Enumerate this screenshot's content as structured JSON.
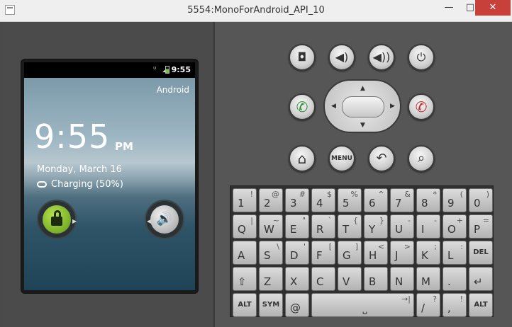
{
  "window": {
    "title": "5554:MonoForAndroid_API_10",
    "min_glyph": "—",
    "max_glyph": "□",
    "close_glyph": "✕"
  },
  "phone": {
    "status_time": "9:55",
    "status_icons": "ᵁ ◢",
    "carrier": "Android",
    "clock": "9:55",
    "ampm": "PM",
    "date": "Monday, March 16",
    "charging": "Charging (50%)",
    "sound_glyph": "🔊"
  },
  "hardware": {
    "camera_glyph": "◘",
    "vol_down_glyph": "◀)",
    "vol_up_glyph": "◀))",
    "power_glyph": "⏻",
    "call_glyph": "✆",
    "end_call_glyph": "✆",
    "home_glyph": "⌂",
    "menu_label": "MENU",
    "back_glyph": "↶",
    "search_glyph": "⌕",
    "dpad": {
      "up": "▲",
      "down": "▼",
      "left": "◀",
      "right": "▶"
    }
  },
  "keyboard": {
    "rows": [
      [
        {
          "m": "1",
          "a": "!"
        },
        {
          "m": "2",
          "a": "@"
        },
        {
          "m": "3",
          "a": "#"
        },
        {
          "m": "4",
          "a": "$"
        },
        {
          "m": "5",
          "a": "%"
        },
        {
          "m": "6",
          "a": "^"
        },
        {
          "m": "7",
          "a": "&"
        },
        {
          "m": "8",
          "a": "*"
        },
        {
          "m": "9",
          "a": "("
        },
        {
          "m": "0",
          "a": ")"
        }
      ],
      [
        {
          "m": "Q",
          "a": "|"
        },
        {
          "m": "W",
          "a": "~"
        },
        {
          "m": "E",
          "a": "\""
        },
        {
          "m": "R",
          "a": "`"
        },
        {
          "m": "T",
          "a": "{"
        },
        {
          "m": "Y",
          "a": "}"
        },
        {
          "m": "U",
          "a": "-"
        },
        {
          "m": "I",
          "a": "-"
        },
        {
          "m": "O",
          "a": "+"
        },
        {
          "m": "P",
          "a": "="
        }
      ],
      [
        {
          "m": "A",
          "a": ""
        },
        {
          "m": "S",
          "a": "\\"
        },
        {
          "m": "D",
          "a": "'"
        },
        {
          "m": "F",
          "a": "["
        },
        {
          "m": "G",
          "a": "]"
        },
        {
          "m": "H",
          "a": "<"
        },
        {
          "m": "J",
          "a": ">"
        },
        {
          "m": "K",
          "a": ";"
        },
        {
          "m": "L",
          "a": ":"
        },
        {
          "m": "",
          "a": "DEL"
        }
      ],
      [
        {
          "m": "⇧",
          "a": ""
        },
        {
          "m": "Z",
          "a": ""
        },
        {
          "m": "X",
          "a": ""
        },
        {
          "m": "C",
          "a": ""
        },
        {
          "m": "V",
          "a": ""
        },
        {
          "m": "B",
          "a": ""
        },
        {
          "m": "N",
          "a": ""
        },
        {
          "m": "M",
          "a": ""
        },
        {
          "m": ".",
          "a": ""
        },
        {
          "m": "↵",
          "a": ""
        }
      ],
      [
        {
          "m": "ALT",
          "a": ""
        },
        {
          "m": "SYM",
          "a": ""
        },
        {
          "m": "@",
          "a": ""
        },
        {
          "m": "⎵",
          "a": "→|"
        },
        {
          "m": "/",
          "a": "?"
        },
        {
          "m": ",",
          "a": "!"
        },
        {
          "m": "ALT",
          "a": ""
        }
      ]
    ]
  }
}
